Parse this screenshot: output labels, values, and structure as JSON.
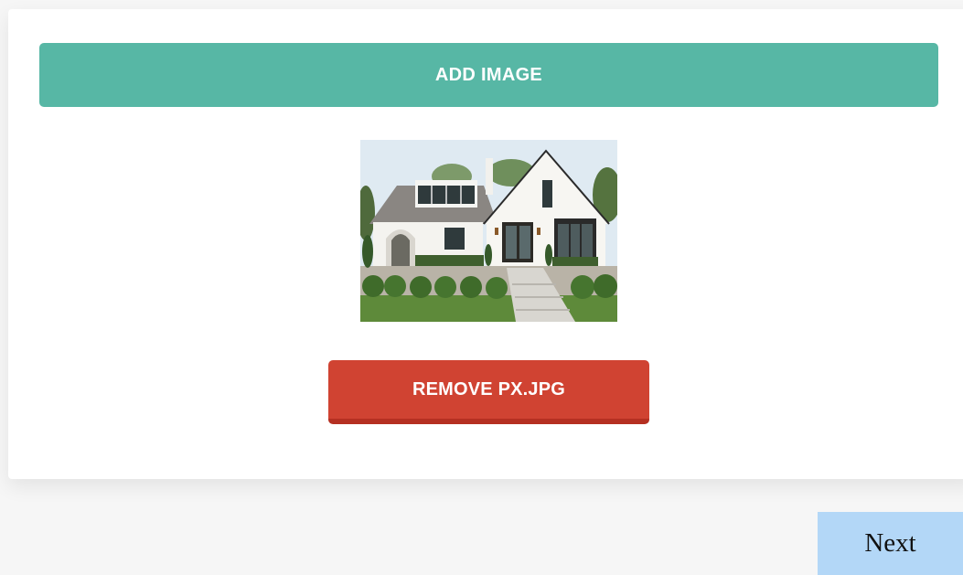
{
  "upload": {
    "add_label": "ADD IMAGE",
    "preview_alt": "px.jpg",
    "remove_label": "REMOVE PX.JPG"
  },
  "navigation": {
    "next_label": "Next"
  },
  "colors": {
    "add_button": "#57b7a5",
    "remove_button": "#d04332",
    "next_button": "#b3d7f7"
  }
}
